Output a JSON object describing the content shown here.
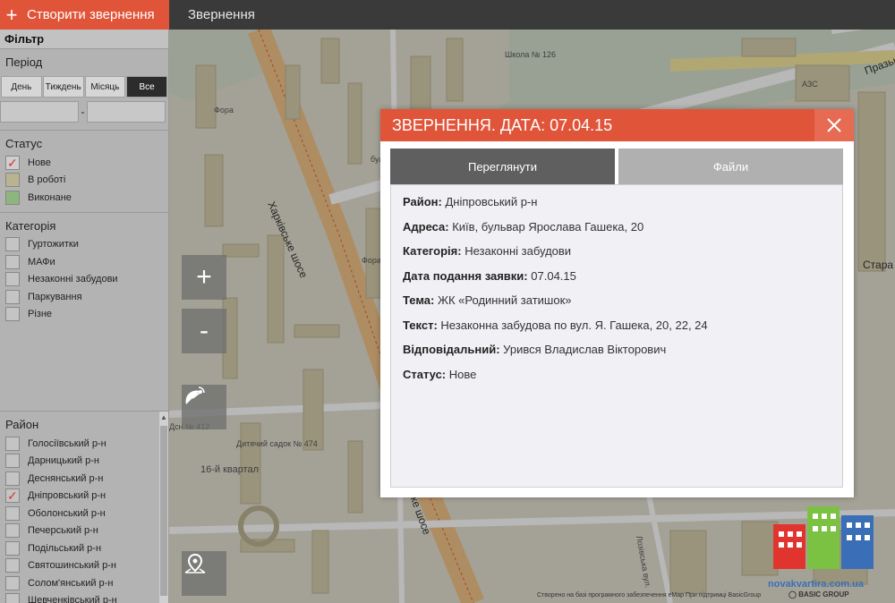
{
  "topbar": {
    "create_label": "Створити звернення",
    "nav_title": "Звернення"
  },
  "sidebar": {
    "filter_title": "Фільтр",
    "period": {
      "title": "Період",
      "buttons": [
        "День",
        "Тиждень",
        "Місяць",
        "Все"
      ],
      "active": "Все"
    },
    "status": {
      "title": "Статус",
      "items": [
        {
          "label": "Нове",
          "checked": true,
          "color": "#b3b3b3"
        },
        {
          "label": "В роботі",
          "checked": false,
          "color": "#b9b48f"
        },
        {
          "label": "Виконане",
          "checked": false,
          "color": "#8fb57e"
        }
      ]
    },
    "category": {
      "title": "Категорія",
      "items": [
        "Гуртожитки",
        "МАФи",
        "Незаконні забудови",
        "Паркування",
        "Різне"
      ]
    },
    "raion": {
      "title": "Район",
      "items": [
        {
          "label": "Голосіївський р-н",
          "checked": false
        },
        {
          "label": "Дарницький р-н",
          "checked": false
        },
        {
          "label": "Деснянський р-н",
          "checked": false
        },
        {
          "label": "Дніпровський р-н",
          "checked": true
        },
        {
          "label": "Оболонський р-н",
          "checked": false
        },
        {
          "label": "Печерський р-н",
          "checked": false
        },
        {
          "label": "Подільський р-н",
          "checked": false
        },
        {
          "label": "Святошинський р-н",
          "checked": false
        },
        {
          "label": "Солом'янський р-н",
          "checked": false
        },
        {
          "label": "Шевченківський р-н",
          "checked": false
        }
      ]
    }
  },
  "map": {
    "zoom_in": "+",
    "zoom_out": "-",
    "labels": {
      "school": "Школа № 126",
      "fora1": "Фора",
      "fora2": "Фора",
      "azs": "АЗС",
      "kindergarten": "Дитячий садок № 474",
      "kvartal": "16-й квартал",
      "dsnz": "Дсн № 412",
      "kharkivske": "Харківське шосе",
      "shose2": "ке шосе",
      "prazka": "Празька",
      "stara": "Стара",
      "lozivska": "Лозівська вул.",
      "bul": "бул"
    },
    "footer": "Створено на базі програмного забезпечення eMap  При підтримці BasicGroup",
    "basic_logo": "BASIC GROUP",
    "watermark": "novakvartira.com.ua"
  },
  "modal": {
    "title": "ЗВЕРНЕННЯ. ДАТА: 07.04.15",
    "tabs": [
      "Переглянути",
      "Файли"
    ],
    "fields": [
      {
        "label": "Район:",
        "value": "Дніпровський р-н"
      },
      {
        "label": "Адреса:",
        "value": "Київ, бульвар Ярослава Гашека, 20"
      },
      {
        "label": "Категорія:",
        "value": "Незаконні забудови"
      },
      {
        "label": "Дата подання заявки:",
        "value": "07.04.15"
      },
      {
        "label": "Тема:",
        "value": "ЖК «Родинний затишок»"
      },
      {
        "label": "Текст:",
        "value": "Незаконна забудова по вул. Я. Гашека, 20, 22, 24"
      },
      {
        "label": "Відповідальний:",
        "value": "Урився Владислав Вікторович"
      },
      {
        "label": "Статус:",
        "value": "Нове"
      }
    ]
  }
}
